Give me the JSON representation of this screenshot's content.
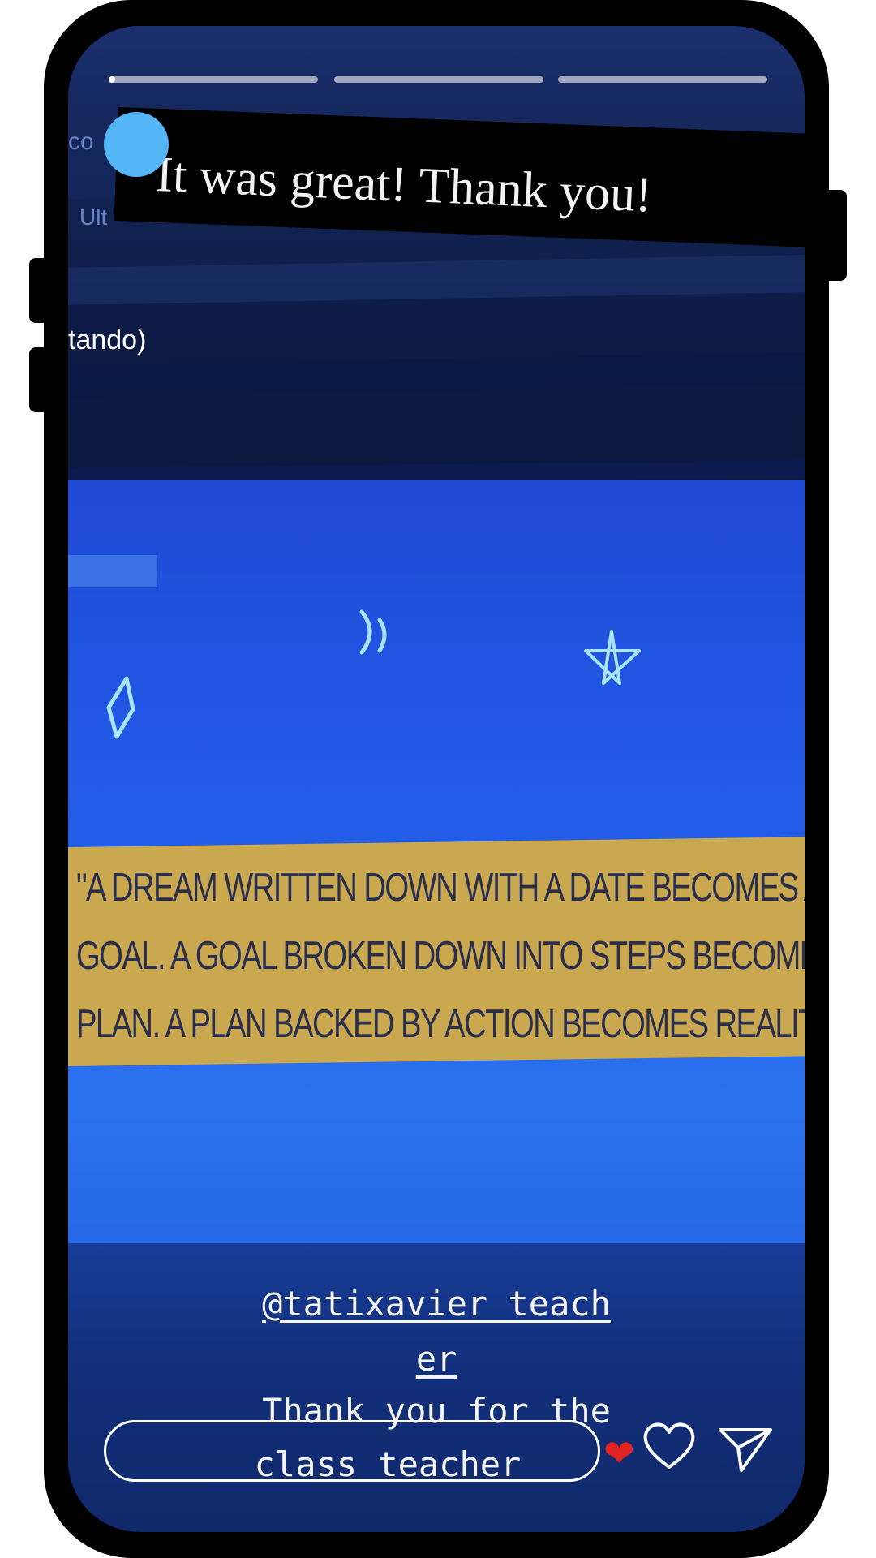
{
  "story": {
    "caption": "It was great! Thank you!",
    "mention": "@tatixavier_teach",
    "mention_cont": "er",
    "message_line1": "Thank you for the",
    "message_line2": "class teacher",
    "progress": [
      0.02,
      0,
      0
    ]
  },
  "photo": {
    "faint_label_1": "co",
    "faint_label_2": "Ult",
    "side_text": "tando)",
    "quote_lines": [
      "\"A DREAM WRITTEN DOWN WITH A DATE BECOMES A",
      "GOAL. A GOAL BROKEN DOWN INTO STEPS BECOMES A",
      "PLAN. A PLAN BACKED BY ACTION BECOMES REALITY."
    ]
  },
  "reply": {
    "placeholder": ""
  },
  "icons": {
    "like": "heart-outline-icon",
    "send": "send-paper-plane-icon",
    "reaction": "red-heart-emoji-icon"
  },
  "colors": {
    "avatar": "#55b6f7",
    "quote_band": "#c9a84f",
    "screen_bg": "#10296b"
  }
}
